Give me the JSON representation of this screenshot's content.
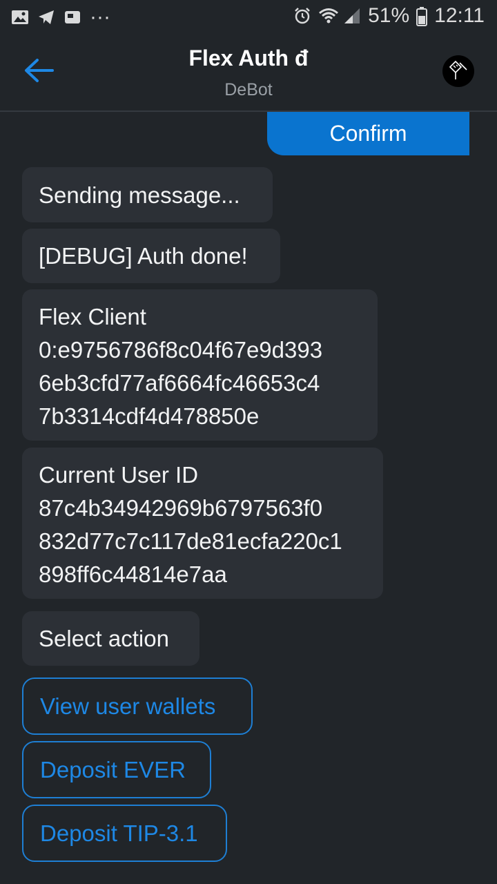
{
  "status_bar": {
    "battery_percent": "51%",
    "time": "12:11",
    "more_dots": "···"
  },
  "header": {
    "title": "Flex Auth đ",
    "subtitle": "DeBot"
  },
  "chat": {
    "confirm_label": "Confirm",
    "messages": [
      {
        "lines": [
          "Sending message..."
        ]
      },
      {
        "lines": [
          "[DEBUG] Auth done!"
        ]
      },
      {
        "lines": [
          "Flex Client",
          "0:e9756786f8c04f67e9d393",
          "6eb3cfd77af6664fc46653c4",
          "7b3314cdf4d478850e"
        ]
      },
      {
        "lines": [
          "Current User ID",
          "87c4b34942969b6797563f0",
          "832d77c7c117de81ecfa220c1",
          "898ff6c44814e7aa"
        ]
      },
      {
        "lines": [
          "Select action"
        ]
      }
    ],
    "actions": [
      {
        "label": "View user wallets"
      },
      {
        "label": "Deposit EVER"
      },
      {
        "label": "Deposit TIP-3.1"
      }
    ]
  },
  "colors": {
    "background": "#212529",
    "bubble": "#2c3036",
    "accent": "#0a74cf",
    "link": "#1e88e5"
  }
}
